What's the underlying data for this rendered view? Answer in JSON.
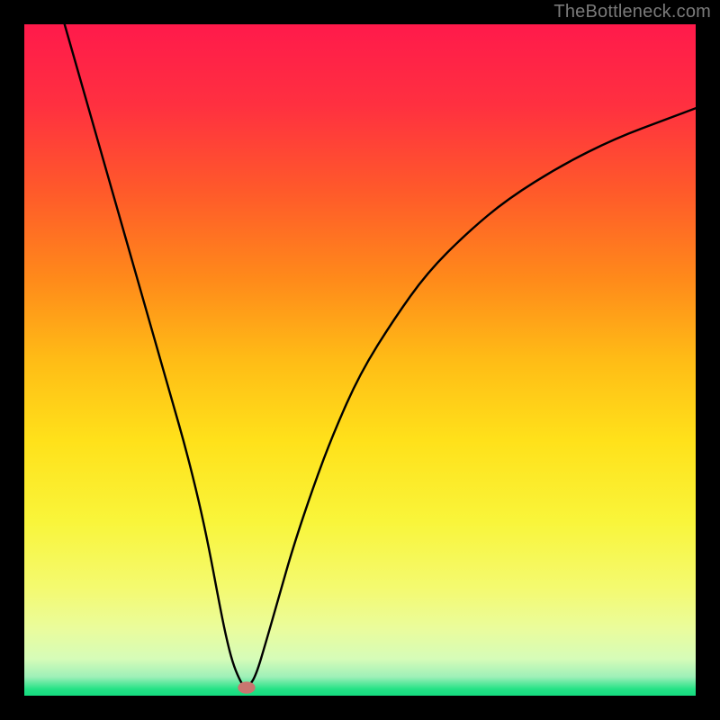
{
  "watermark": "TheBottleneck.com",
  "chart_data": {
    "type": "line",
    "title": "",
    "xlabel": "",
    "ylabel": "",
    "xlim": [
      0,
      100
    ],
    "ylim": [
      0,
      100
    ],
    "background": "rainbow-gradient",
    "gradient_stops": [
      {
        "pos": 0.0,
        "color": "#ff1a4b"
      },
      {
        "pos": 0.12,
        "color": "#ff3040"
      },
      {
        "pos": 0.25,
        "color": "#ff5a2a"
      },
      {
        "pos": 0.38,
        "color": "#ff8a1a"
      },
      {
        "pos": 0.5,
        "color": "#ffbc16"
      },
      {
        "pos": 0.62,
        "color": "#ffe11a"
      },
      {
        "pos": 0.74,
        "color": "#f9f53a"
      },
      {
        "pos": 0.84,
        "color": "#f4fa70"
      },
      {
        "pos": 0.9,
        "color": "#eafc9c"
      },
      {
        "pos": 0.945,
        "color": "#d6fcb8"
      },
      {
        "pos": 0.972,
        "color": "#9ef0b8"
      },
      {
        "pos": 0.99,
        "color": "#25e286"
      },
      {
        "pos": 1.0,
        "color": "#14db7f"
      }
    ],
    "series": [
      {
        "name": "bottleneck-curve",
        "color": "#000000",
        "x": [
          6,
          8,
          10,
          12,
          14,
          16,
          18,
          20,
          22,
          24,
          26,
          27.5,
          29,
          30,
          31,
          32,
          32.8,
          33.4,
          34.5,
          36,
          38,
          40,
          43,
          46,
          50,
          55,
          60,
          66,
          72,
          80,
          88,
          96,
          100
        ],
        "y": [
          100,
          93,
          86,
          79,
          72,
          65,
          58,
          51,
          44,
          37,
          29,
          22,
          14,
          9,
          5,
          2.5,
          1.2,
          1.3,
          3,
          8,
          15,
          22,
          31,
          39,
          48,
          56,
          63,
          69,
          74,
          79,
          83,
          86,
          87.5
        ]
      }
    ],
    "marker": {
      "name": "min-point",
      "x": 33.1,
      "y": 1.2,
      "rx": 1.3,
      "ry": 0.9,
      "color": "#c97670"
    }
  }
}
